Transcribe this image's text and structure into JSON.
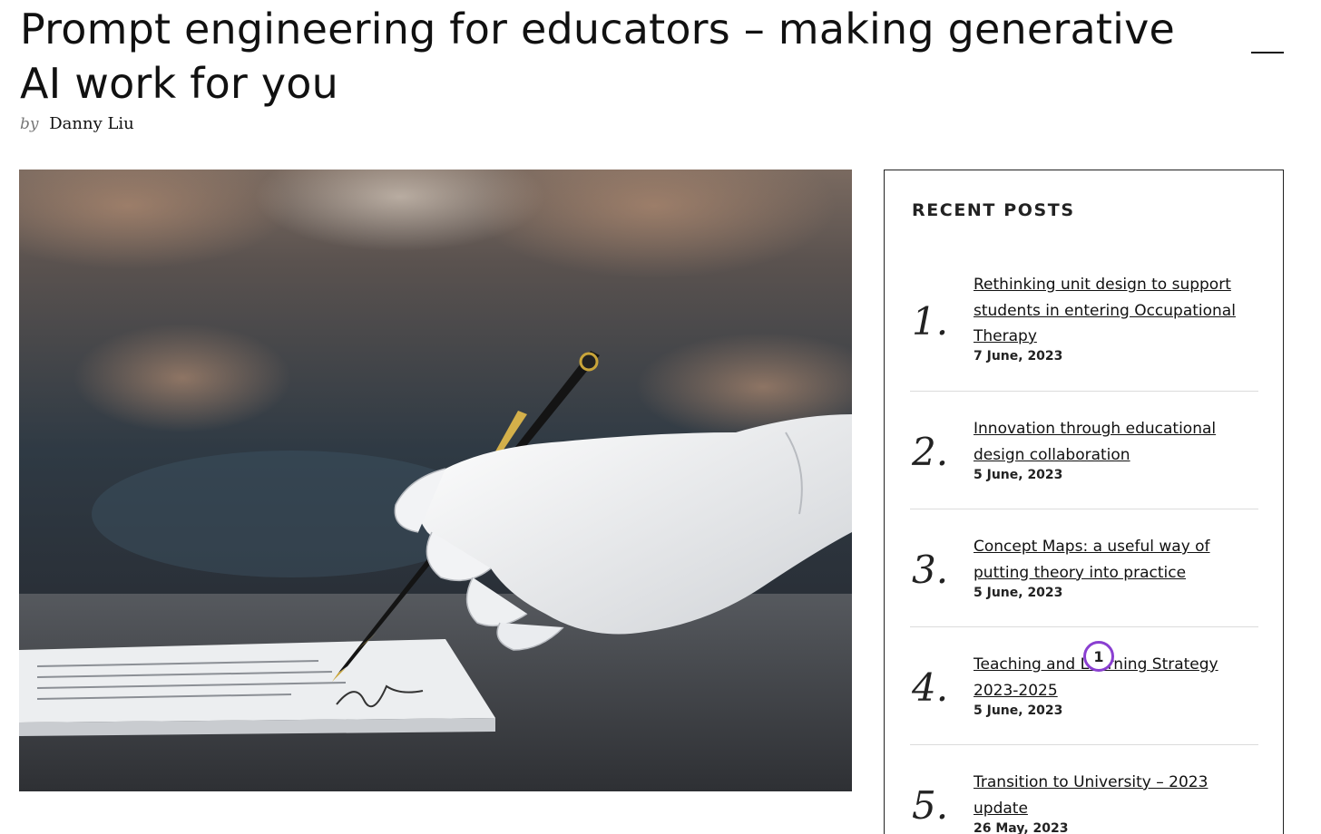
{
  "post": {
    "title": "Prompt engineering for educators – making generative AI work for you",
    "byline_prefix": "by",
    "author": "Danny Liu"
  },
  "hero_image": {
    "description_icon": "robot-hand-signing-document-image"
  },
  "sidebar": {
    "heading": "RECENT POSTS",
    "posts": [
      {
        "number": "1.",
        "title": "Rethinking unit design to support students in entering Occupational Therapy",
        "date": "7 June, 2023"
      },
      {
        "number": "2.",
        "title": "Innovation through educational design collaboration",
        "date": "5 June, 2023"
      },
      {
        "number": "3.",
        "title": "Concept Maps: a useful way of putting theory into practice",
        "date": "5 June, 2023"
      },
      {
        "number": "4.",
        "title": "Teaching and Learning Strategy 2023-2025",
        "date": "5 June, 2023"
      },
      {
        "number": "5.",
        "title": "Transition to University – 2023 update",
        "date": "26 May, 2023"
      }
    ]
  },
  "cursor_marker": {
    "label": "1",
    "color": "#8a3fd1"
  },
  "colors": {
    "text": "#111111",
    "border": "#222222",
    "divider": "#dcdcdc"
  }
}
